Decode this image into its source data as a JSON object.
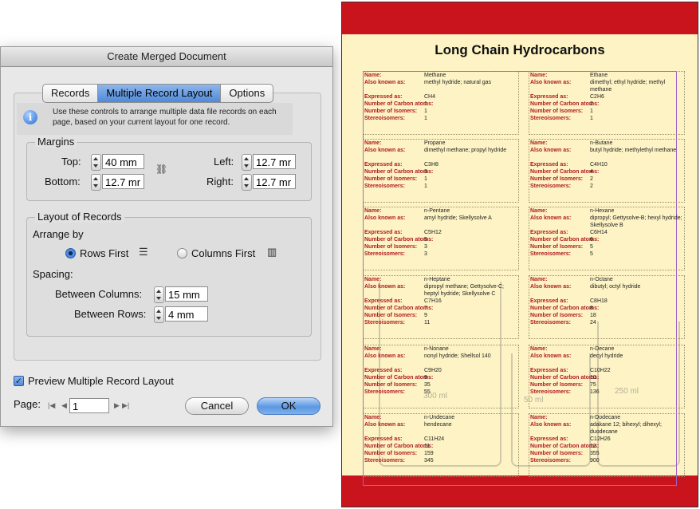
{
  "dialog": {
    "title": "Create Merged Document",
    "tabs": [
      "Records",
      "Multiple Record Layout",
      "Options"
    ],
    "active_tab": "Multiple Record Layout",
    "info_text": "Use these controls to arrange multiple data file records on each page, based on your current layout for one record.",
    "margins": {
      "title": "Margins",
      "top_label": "Top:",
      "top_value": "40 mm",
      "bottom_label": "Bottom:",
      "bottom_value": "12.7 mr",
      "left_label": "Left:",
      "left_value": "12.7 mr",
      "right_label": "Right:",
      "right_value": "12.7 mr"
    },
    "layout": {
      "title": "Layout of Records",
      "arrange_label": "Arrange by",
      "rows_first": "Rows First",
      "columns_first": "Columns First",
      "selected": "Rows First",
      "spacing_label": "Spacing:",
      "between_columns_label": "Between Columns:",
      "between_columns_value": "15 mm",
      "between_rows_label": "Between Rows:",
      "between_rows_value": "4 mm"
    },
    "preview_label": "Preview Multiple Record Layout",
    "preview_checked": true,
    "page_label": "Page:",
    "page_value": "1",
    "cancel_label": "Cancel",
    "ok_label": "OK"
  },
  "document": {
    "title": "Long Chain Hydrocarbons",
    "band_color": "#c9141d",
    "background_color": "#fdf3c4",
    "field_labels": [
      "Name:",
      "Also known as:",
      "Expressed as:",
      "Number of Carbon atoms:",
      "Number of Isomers:",
      "Stereoisomers:"
    ],
    "beaker_labels": [
      "300 ml",
      "50 ml",
      "250 ml"
    ],
    "records": [
      {
        "name": "Methane",
        "aka": "methyl hydride; natural gas",
        "formula": "CH4",
        "carbon": "1",
        "isomers": "1",
        "stereo": "1"
      },
      {
        "name": "Ethane",
        "aka": "dimethyl; ethyl hydride; methyl methane",
        "formula": "C2H6",
        "carbon": "2",
        "isomers": "1",
        "stereo": "1"
      },
      {
        "name": "Propane",
        "aka": "dimethyl methane; propyl hydride",
        "formula": "C3H8",
        "carbon": "3",
        "isomers": "1",
        "stereo": "1"
      },
      {
        "name": "n-Butane",
        "aka": "butyl hydride; methylethyl methane",
        "formula": "C4H10",
        "carbon": "4",
        "isomers": "2",
        "stereo": "2"
      },
      {
        "name": "n-Pentane",
        "aka": "amyl hydride; Skellysolve A",
        "formula": "C5H12",
        "carbon": "5",
        "isomers": "3",
        "stereo": "3"
      },
      {
        "name": "n-Hexane",
        "aka": "dipropyl; Gettysolve-B; hexyl hydride; Skellysolve B",
        "formula": "C6H14",
        "carbon": "6",
        "isomers": "5",
        "stereo": "5"
      },
      {
        "name": "n-Heptane",
        "aka": "dipropyl methane; Gettysolve-C; heptyl hydride; Skellysolve C",
        "formula": "C7H16",
        "carbon": "7",
        "isomers": "9",
        "stereo": "11"
      },
      {
        "name": "n-Octane",
        "aka": "dibutyl; octyl hydride",
        "formula": "C8H18",
        "carbon": "8",
        "isomers": "18",
        "stereo": "24"
      },
      {
        "name": "n-Nonane",
        "aka": "nonyl hydride; Shellsol 140",
        "formula": "C9H20",
        "carbon": "9",
        "isomers": "35",
        "stereo": "55"
      },
      {
        "name": "n-Decane",
        "aka": "decyl hydride",
        "formula": "C10H22",
        "carbon": "10",
        "isomers": "75",
        "stereo": "136"
      },
      {
        "name": "n-Undecane",
        "aka": "hendecane",
        "formula": "C11H24",
        "carbon": "11",
        "isomers": "159",
        "stereo": "345"
      },
      {
        "name": "n-Dodecane",
        "aka": "adakane 12; bihexyl; dihexyl; duodecane",
        "formula": "C12H26",
        "carbon": "12",
        "isomers": "355",
        "stereo": "900"
      }
    ]
  }
}
